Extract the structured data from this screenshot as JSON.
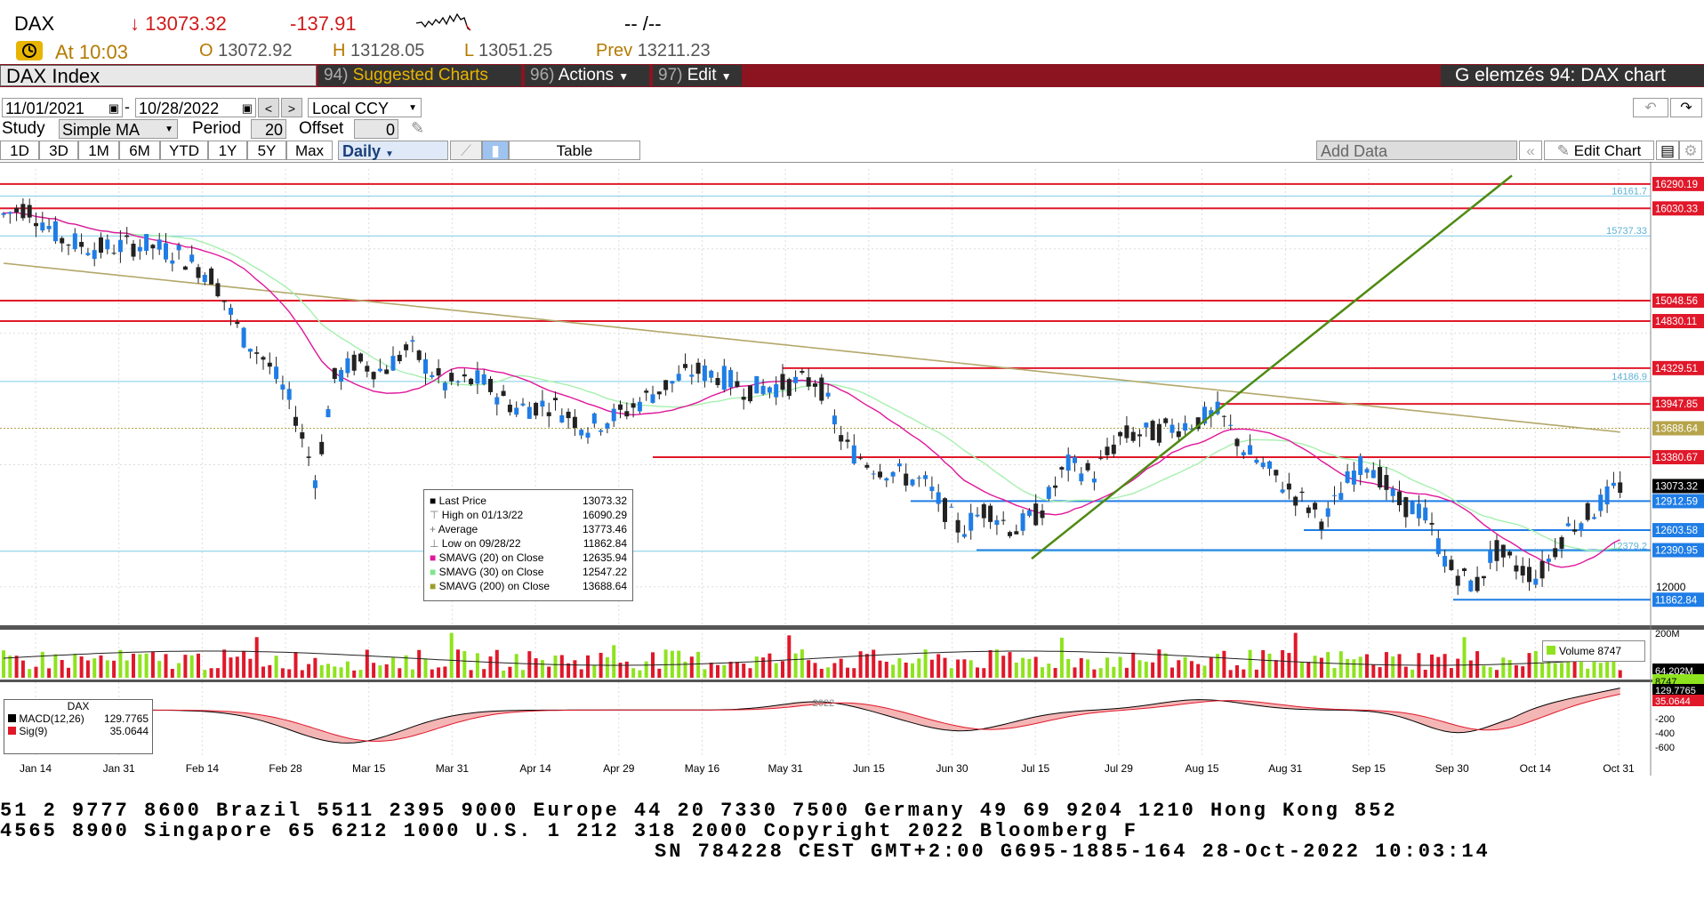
{
  "quote": {
    "ticker": "DAX",
    "last": "13073.32",
    "change": "-137.91",
    "time_label": "At 10:03",
    "open_label": "O",
    "open": "13072.92",
    "high_label": "H",
    "high": "13128.05",
    "low_label": "L",
    "low": "13051.25",
    "prev_label": "Prev",
    "prev": "13211.23",
    "misc": "-- /--"
  },
  "menu": {
    "security": "DAX Index",
    "suggested": {
      "num": "94)",
      "label": "Suggested Charts"
    },
    "actions": {
      "num": "96)",
      "label": "Actions"
    },
    "edit": {
      "num": "97)",
      "label": "Edit"
    },
    "title": "G elemzés 94: DAX chart"
  },
  "controls": {
    "start_date": "11/01/2021",
    "end_date": "10/28/2022",
    "currency": "Local CCY",
    "study_label": "Study",
    "study": "Simple MA",
    "period_label": "Period",
    "period": "20",
    "offset_label": "Offset",
    "offset": "0",
    "add_data": "Add Data",
    "edit_chart": "Edit Chart",
    "table": "Table",
    "ranges": [
      "1D",
      "3D",
      "1M",
      "6M",
      "YTD",
      "1Y",
      "5Y",
      "Max"
    ],
    "frequency": "Daily"
  },
  "legend": {
    "items": [
      {
        "label": "Last Price",
        "value": "13073.32",
        "color": "#000000"
      },
      {
        "label": "High on 01/13/22",
        "value": "16090.29",
        "color": ""
      },
      {
        "label": "Average",
        "value": "13773.46",
        "color": ""
      },
      {
        "label": "Low on 09/28/22",
        "value": "11862.84",
        "color": ""
      },
      {
        "label": "SMAVG (20)  on Close",
        "value": "12635.94",
        "color": "#e0169b"
      },
      {
        "label": "SMAVG (30)  on Close",
        "value": "12547.22",
        "color": "#7fe58d"
      },
      {
        "label": "SMAVG (200)  on Close",
        "value": "13688.64",
        "color": "#9c9c2a"
      }
    ]
  },
  "volume_legend": "Volume 8747",
  "macd_legend": {
    "title": "DAX",
    "macd_label": "MACD(12,26)",
    "macd_value": "129.7765",
    "sig_label": "Sig(9)",
    "sig_value": "35.0644"
  },
  "chart_data": {
    "type": "candlestick",
    "x_tick_labels": [
      "Jan 14",
      "Jan 31",
      "Feb 14",
      "Feb 28",
      "Mar 15",
      "Mar 31",
      "Apr 14",
      "Apr 29",
      "May 16",
      "May 31",
      "Jun 15",
      "Jun 30",
      "Jul 15",
      "Jul 29",
      "Aug 15",
      "Aug 31",
      "Sep 15",
      "Sep 30",
      "Oct 14",
      "Oct 31"
    ],
    "year_label": "2022",
    "y_axis_level": "12000",
    "price_ylim": [
      11600,
      16450
    ],
    "price_labels": [
      {
        "value": 16290.19,
        "text": "16290.19",
        "kind": "red"
      },
      {
        "value": 16030.33,
        "text": "16030.33",
        "kind": "red"
      },
      {
        "value": 15048.56,
        "text": "15048.56",
        "kind": "red"
      },
      {
        "value": 14830.11,
        "text": "14830.11",
        "kind": "red"
      },
      {
        "value": 14329.51,
        "text": "14329.51",
        "kind": "red"
      },
      {
        "value": 13947.85,
        "text": "13947.85",
        "kind": "red"
      },
      {
        "value": 13688.64,
        "text": "13688.64",
        "kind": "olive"
      },
      {
        "value": 13380.67,
        "text": "13380.67",
        "kind": "red"
      },
      {
        "value": 13073.32,
        "text": "13073.32",
        "kind": "black"
      },
      {
        "value": 12912.59,
        "text": "12912.59",
        "kind": "blue"
      },
      {
        "value": 12603.58,
        "text": "12603.58",
        "kind": "blue"
      },
      {
        "value": 12390.95,
        "text": "12390.95",
        "kind": "blue"
      },
      {
        "value": 11862.84,
        "text": "11862.84",
        "kind": "blue"
      }
    ],
    "fib_labels": [
      {
        "value": 16161.7,
        "text": "16161.7"
      },
      {
        "value": 15737.33,
        "text": "15737.33"
      },
      {
        "value": 14186.9,
        "text": "14186.9"
      },
      {
        "value": 12379.2,
        "text": "12379.2"
      }
    ],
    "volume_ticks": [
      "200M",
      "64.202M",
      "8747"
    ],
    "macd_ticks": [
      "129.7765",
      "35.0644",
      "-200",
      "-400",
      "-600"
    ]
  },
  "footer": {
    "line1": "51 2 9777 8600 Brazil 5511 2395 9000 Europe 44 20 7330 7500 Germany 49 69 9204 1210 Hong Kong 852",
    "line2": "4565 8900        Singapore 65 6212 1000        U.S. 1 212 318 2000        Copyright 2022 Bloomberg F",
    "line3": "SN 784228 CEST GMT+2:00 G695-1885-164 28-Oct-2022 10:03:14"
  },
  "colors": {
    "accent": "#8b1420",
    "up": "#1f7de6",
    "down": "#222222",
    "sma20": "#e0169b",
    "sma30": "#a6f0ae",
    "sma200": "#b3a86a",
    "trend": "#4e8a12",
    "volume_up": "#8fe31e",
    "volume_down": "#e0182a"
  }
}
